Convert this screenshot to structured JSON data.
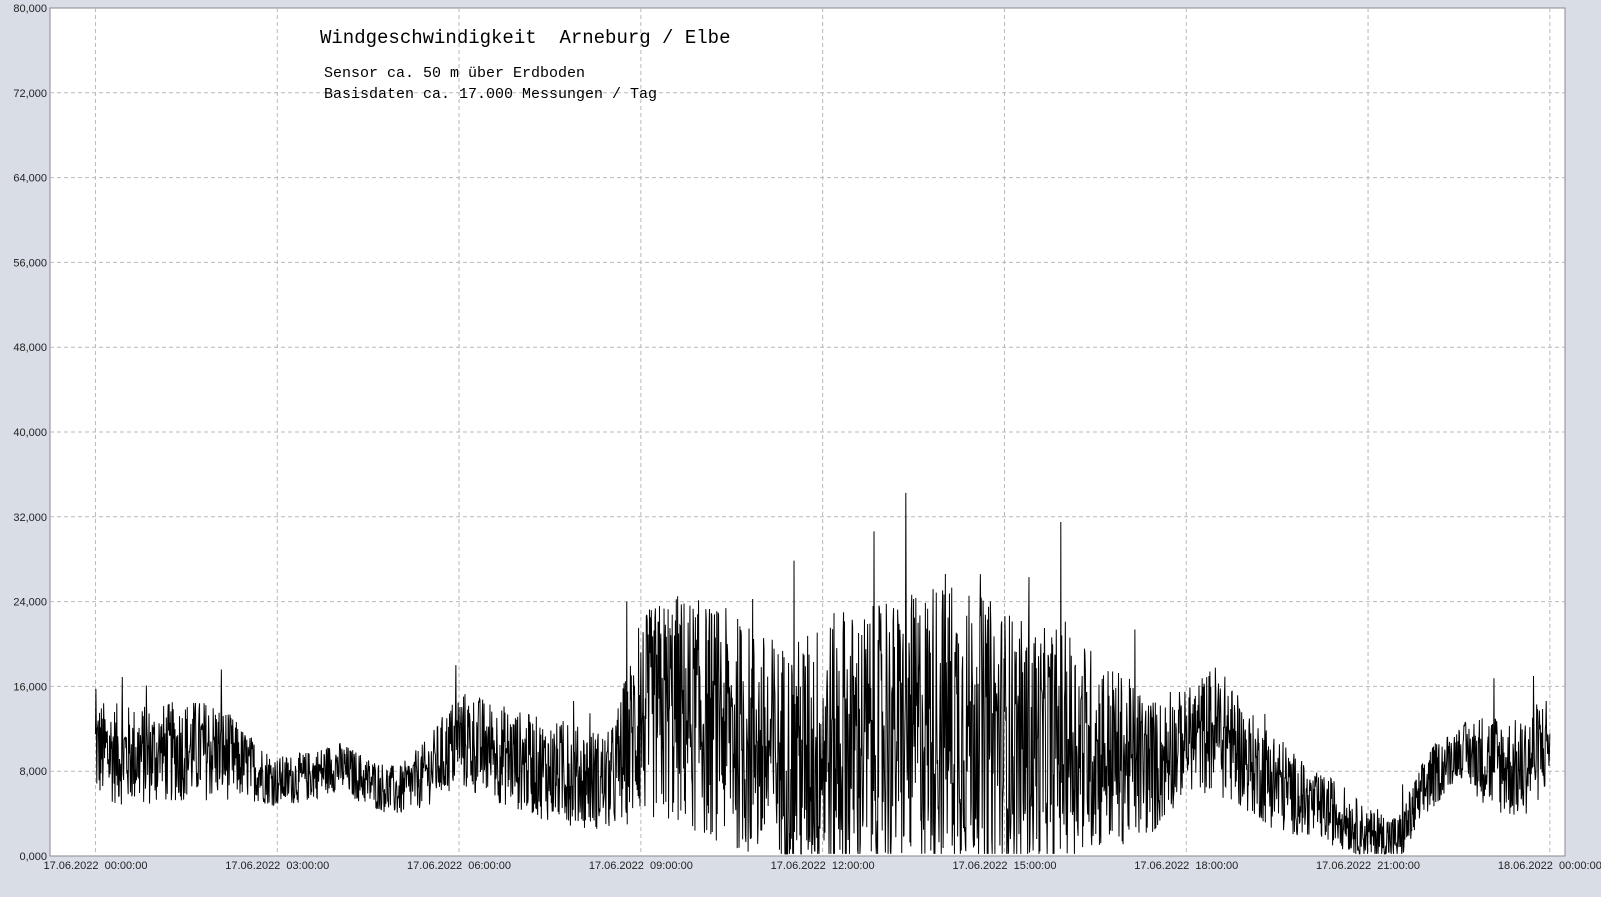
{
  "chart_data": {
    "type": "line",
    "title": "Windgeschwindigkeit  Arneburg / Elbe",
    "subtitle_lines": [
      "Sensor ca. 50 m über Erdboden",
      "Basisdaten ca. 17.000 Messungen / Tag"
    ],
    "xlabel": "",
    "ylabel": "",
    "ylim": [
      0,
      80
    ],
    "y_ticks": [
      0,
      8,
      16,
      24,
      32,
      40,
      48,
      56,
      64,
      72,
      80
    ],
    "y_tick_labels": [
      "0,000",
      "8,000",
      "16,000",
      "24,000",
      "32,000",
      "40,000",
      "48,000",
      "56,000",
      "64,000",
      "72,000",
      "80,000"
    ],
    "x_range_hours": [
      -0.75,
      24.25
    ],
    "x_ticks_hours": [
      0,
      3,
      6,
      9,
      12,
      15,
      18,
      21,
      24
    ],
    "x_tick_labels": [
      "17.06.2022  00:00:00",
      "17.06.2022  03:00:00",
      "17.06.2022  06:00:00",
      "17.06.2022  09:00:00",
      "17.06.2022  12:00:00",
      "17.06.2022  15:00:00",
      "17.06.2022  18:00:00",
      "17.06.2022  21:00:00",
      "18.06.2022  00:00:00"
    ],
    "grid": true,
    "legend": "none",
    "series": [
      {
        "color": "#000000",
        "x_hours": [
          0,
          0.5,
          1,
          1.5,
          2,
          2.5,
          3,
          3.5,
          4,
          4.5,
          5,
          5.5,
          6,
          6.5,
          7,
          7.5,
          8,
          8.5,
          9,
          9.5,
          10,
          10.5,
          11,
          11.5,
          12,
          12.5,
          13,
          13.5,
          14,
          14.5,
          15,
          15.5,
          16,
          16.5,
          17,
          17.5,
          18,
          18.5,
          19,
          19.5,
          20,
          20.5,
          21,
          21.5,
          22,
          22.5,
          23,
          23.5,
          24
        ],
        "mean": [
          10,
          9.5,
          9.5,
          10,
          10,
          8.5,
          7,
          7.5,
          8.5,
          7,
          6,
          8,
          11,
          10,
          9,
          8,
          7.5,
          7,
          13,
          14,
          13,
          12,
          10,
          9,
          10,
          10.5,
          11,
          12,
          13,
          12,
          11,
          10,
          11,
          10,
          9,
          8.5,
          11,
          12,
          9,
          7,
          5,
          4,
          2,
          1.5,
          7,
          10,
          9,
          8,
          11
        ],
        "amplitude": [
          3,
          3,
          3,
          3,
          3,
          2,
          1.5,
          1.5,
          1.5,
          1.5,
          1.5,
          2,
          3,
          3,
          3,
          3,
          3,
          3,
          6,
          7,
          7,
          7,
          7,
          7,
          8,
          8,
          8,
          8,
          9,
          8,
          8,
          7,
          7,
          6,
          5,
          4,
          3,
          4,
          3,
          3,
          2,
          2,
          1.5,
          1.5,
          2,
          1.5,
          3,
          3,
          3
        ]
      }
    ]
  }
}
